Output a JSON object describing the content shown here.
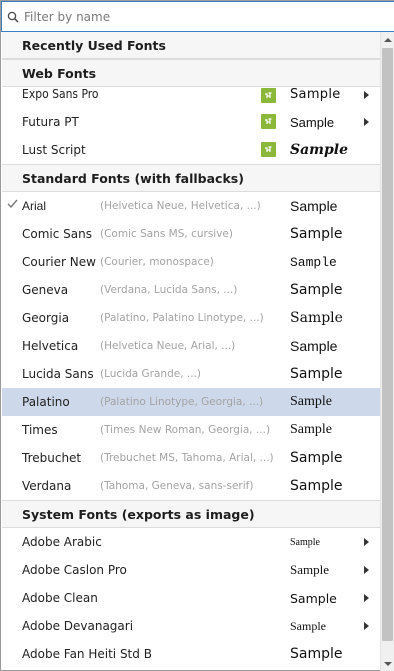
{
  "filter": {
    "placeholder": "Filter by name",
    "value": ""
  },
  "sections": {
    "recent": "Recently Used Fonts",
    "web": "Web Fonts",
    "standard": "Standard Fonts (with fallbacks)",
    "system": "System Fonts (exports as image)"
  },
  "web_fonts": [
    {
      "name": "Expo Sans Pro",
      "sample": "Sample"
    },
    {
      "name": "Futura PT",
      "sample": "Sample"
    },
    {
      "name": "Lust Script",
      "sample": "Sample"
    }
  ],
  "standard_fonts": [
    {
      "name": "Arial",
      "fallback": "(Helvetica Neue, Helvetica, ...)",
      "sample": "Sample",
      "checked": true
    },
    {
      "name": "Comic Sans",
      "fallback": "(Comic Sans MS, cursive)",
      "sample": "Sample"
    },
    {
      "name": "Courier New",
      "fallback": "(Courier, monospace)",
      "sample": "Sample"
    },
    {
      "name": "Geneva",
      "fallback": "(Verdana, Lucida Sans, ...)",
      "sample": "Sample"
    },
    {
      "name": "Georgia",
      "fallback": "(Palatino, Palatino Linotype, ...)",
      "sample": "Sample"
    },
    {
      "name": "Helvetica",
      "fallback": "(Helvetica Neue, Arial, ...)",
      "sample": "Sample"
    },
    {
      "name": "Lucida Sans",
      "fallback": "(Lucida Grande, ...)",
      "sample": "Sample"
    },
    {
      "name": "Palatino",
      "fallback": "(Palatino Linotype, Georgia, ...)",
      "sample": "Sample",
      "selected": true
    },
    {
      "name": "Times",
      "fallback": "(Times New Roman, Georgia, ...)",
      "sample": "Sample"
    },
    {
      "name": "Trebuchet",
      "fallback": "(Trebuchet MS, Tahoma, Arial, ...)",
      "sample": "Sample"
    },
    {
      "name": "Verdana",
      "fallback": "(Tahoma, Geneva, sans-serif)",
      "sample": "Sample"
    }
  ],
  "system_fonts": [
    {
      "name": "Adobe Arabic",
      "sample": "Sample"
    },
    {
      "name": "Adobe Caslon Pro",
      "sample": "Sample"
    },
    {
      "name": "Adobe Clean",
      "sample": "Sample"
    },
    {
      "name": "Adobe Devanagari",
      "sample": "Sample"
    },
    {
      "name": "Adobe Fan Heiti Std B",
      "sample": "Sample"
    }
  ],
  "icons": {
    "search": "search-icon",
    "web_font_badge": "web-font-icon",
    "submenu": "chevron-right-icon",
    "check": "checkmark-icon"
  },
  "colors": {
    "focus_border": "#3c7fc4",
    "selected_row": "#cdd9ea",
    "web_badge": "#8bb83b"
  }
}
